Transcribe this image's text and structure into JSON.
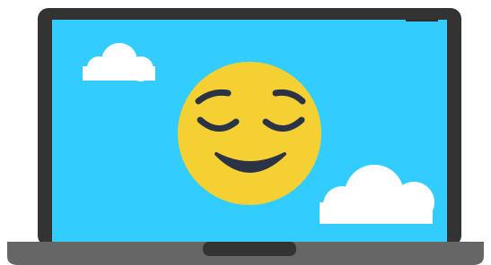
{
  "illustration": {
    "subject": "laptop-with-relieved-face",
    "colors": {
      "laptop_body": "#333333",
      "laptop_base": "#666666",
      "trackpad_notch": "#333333",
      "screen": "#33CCFF",
      "cloud": "#FFFFFF",
      "face": "#F5D033",
      "face_features": "#2B3347"
    },
    "icons": [
      "laptop-icon",
      "cloud-icon",
      "relieved-face-icon"
    ]
  }
}
